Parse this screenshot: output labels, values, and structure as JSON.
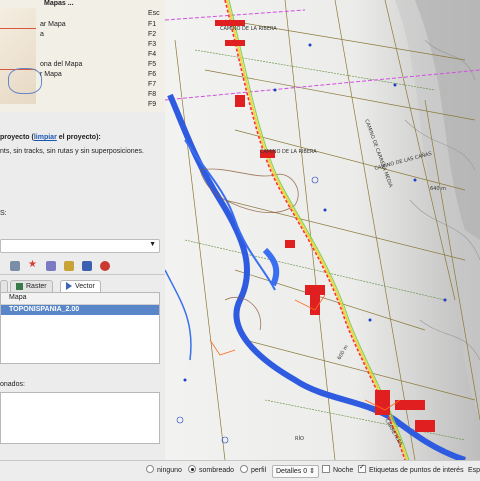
{
  "menu": {
    "title": "Mapas ...",
    "esc": "Esc",
    "items": [
      {
        "label": "ar Mapa",
        "key": "F1"
      },
      {
        "label": "a",
        "key": "F2"
      },
      {
        "label": "",
        "key": "F3"
      },
      {
        "label": "",
        "key": "F4"
      },
      {
        "label": "ona del Mapa",
        "key": "F5"
      },
      {
        "label": "r Mapa",
        "key": "F6"
      },
      {
        "label": "",
        "key": "F7"
      },
      {
        "label": "",
        "key": "F8"
      },
      {
        "label": "",
        "key": "F9"
      }
    ]
  },
  "project": {
    "prefix": "proyecto (",
    "link": "limpiar",
    "suffix": " el proyecto):",
    "description": "nts, sin tracks, sin rutas y sin superposiciones."
  },
  "colon_label": "S:",
  "tabs": {
    "raster": "Raster",
    "vector": "Vector"
  },
  "maps_table": {
    "header": "Mapa",
    "rows": [
      "TOPONISPANIA_2.00"
    ]
  },
  "selected_label": "onados:",
  "map": {
    "labels": {
      "town1": "CAMINO DE LA RIBERA",
      "town2": "CAMINO DE LA RIBERA",
      "road1": "CAMINO DE CARRERA MEDIA",
      "road2": "CAMINO DE LAS CAÑAS",
      "road3": "CARRETERA",
      "alt1": "640 m",
      "alt2": "600 m",
      "river": "RÍO"
    }
  },
  "statusbar": {
    "opt_ninguno": "ninguno",
    "opt_sombreado": "sombreado",
    "opt_perfil": "perfil",
    "detalles": "Detalles 0",
    "noche": "Noche",
    "etiquetas": "Etiquetas de puntos de interés",
    "esp": "Esp"
  }
}
